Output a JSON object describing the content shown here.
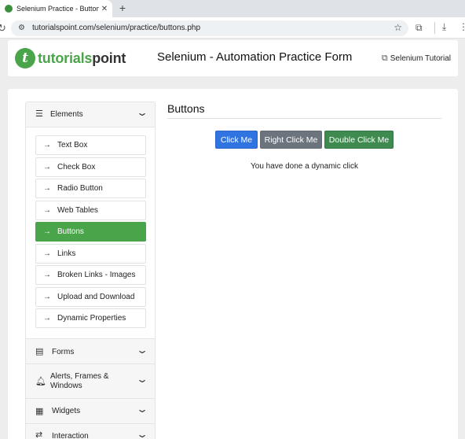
{
  "browser": {
    "tab_title": "Selenium Practice - Buttons",
    "close_glyph": "✕",
    "new_tab_glyph": "+",
    "url": "tutorialspoint.com/selenium/practice/buttons.php",
    "favicon_color": "#3c8f3c"
  },
  "header": {
    "logo_left": "tutorials",
    "logo_right": "point",
    "logo_mark": "t",
    "title": "Selenium - Automation Practice Form",
    "tutorial_link": "Selenium Tutorial",
    "brand_color": "#4aa44a"
  },
  "sidebar": {
    "sections": [
      {
        "label": "Elements",
        "icon": "menu-icon",
        "expanded": true
      },
      {
        "label": "Forms",
        "icon": "form-icon",
        "expanded": false
      },
      {
        "label": "Alerts, Frames & Windows",
        "icon": "bell-icon",
        "expanded": false
      },
      {
        "label": "Widgets",
        "icon": "widgets-icon",
        "expanded": false
      },
      {
        "label": "Interaction",
        "icon": "arrows-icon",
        "expanded": false
      }
    ],
    "items": [
      {
        "label": "Text Box",
        "active": false
      },
      {
        "label": "Check Box",
        "active": false
      },
      {
        "label": "Radio Button",
        "active": false
      },
      {
        "label": "Web Tables",
        "active": false
      },
      {
        "label": "Buttons",
        "active": true
      },
      {
        "label": "Links",
        "active": false
      },
      {
        "label": "Broken Links - Images",
        "active": false
      },
      {
        "label": "Upload and Download",
        "active": false
      },
      {
        "label": "Dynamic Properties",
        "active": false
      }
    ],
    "item_arrow": "→",
    "chevron": "⌄"
  },
  "content": {
    "title": "Buttons",
    "buttons": {
      "click": "Click Me",
      "right_click": "Right Click Me",
      "double_click": "Double Click Me"
    },
    "message": "You have done a dynamic click"
  },
  "colors": {
    "primary": "#2f74e0",
    "secondary": "#6c757d",
    "success": "#3e8a4f",
    "active_item": "#4aa44a"
  }
}
